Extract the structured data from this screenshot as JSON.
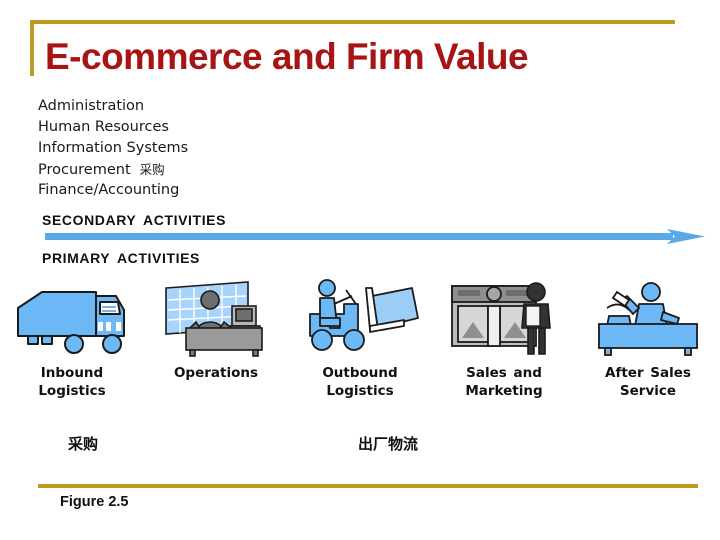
{
  "slide": {
    "title": "E-commerce and Firm Value",
    "accent_gold": "#bd9b22",
    "title_color": "#a81414",
    "arrow_blue": "#5aa9e6",
    "icon_blue": "#6db8f7",
    "icon_gray": "#8a8a8a"
  },
  "support_activities": {
    "rows": [
      {
        "label": "Administration",
        "cn": ""
      },
      {
        "label": "Human Resources",
        "cn": ""
      },
      {
        "label": "Information Systems",
        "cn": ""
      },
      {
        "label": "Procurement",
        "cn": "采购"
      },
      {
        "label": "Finance/Accounting",
        "cn": ""
      }
    ]
  },
  "bands": {
    "secondary_label": "SECONDARY  ACTIVITIES",
    "primary_label": "PRIMARY  ACTIVITIES"
  },
  "value_chain": {
    "steps": [
      {
        "icon": "delivery-truck-icon",
        "label_line1": "Inbound",
        "label_line2": "Logistics"
      },
      {
        "icon": "office-desk-worker-icon",
        "label_line1": "Operations",
        "label_line2": ""
      },
      {
        "icon": "forklift-icon",
        "label_line1": "Outbound",
        "label_line2": "Logistics"
      },
      {
        "icon": "storefront-salesperson-icon",
        "label_line1": "Sales and",
        "label_line2": "Marketing"
      },
      {
        "icon": "service-counter-agent-icon",
        "label_line1": "After Sales",
        "label_line2": "Service"
      }
    ]
  },
  "annotations": {
    "procurement_cn": "采购",
    "outbound_logistics_cn": "出厂物流"
  },
  "footer": {
    "figure_caption": "Figure 2.5"
  }
}
